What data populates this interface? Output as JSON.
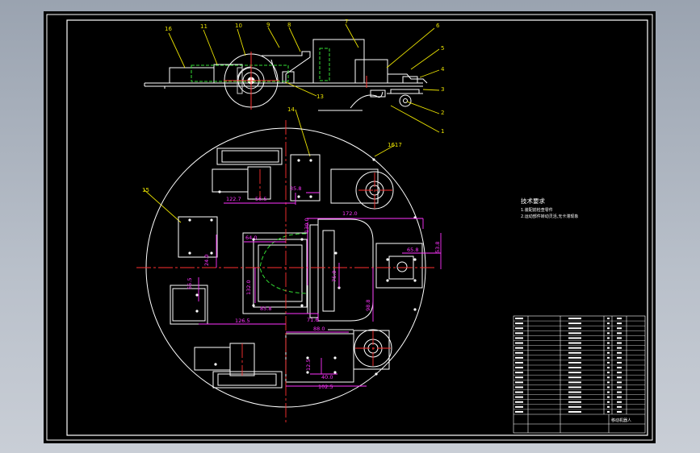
{
  "part_labels": {
    "p16": "16",
    "p11": "11",
    "p10": "10",
    "p9": "9",
    "p8": "8",
    "p7": "7",
    "p6": "6",
    "p5": "5",
    "p4": "4",
    "p3": "3",
    "p2": "2",
    "p1": "1",
    "p13": "13",
    "p14": "14",
    "p15": "15",
    "p1617": "1617"
  },
  "dimensions": {
    "d122_7": "122.7",
    "d56_5": "56.5",
    "d35_8": "35.8",
    "d172_0": "172.0",
    "d64_0": "64.0",
    "d130_0": "130.0",
    "d24_0": "24.0",
    "d65_8": "65.8",
    "d53_8": "53.8",
    "d55_5": "55.5",
    "d132_0": "132.0",
    "d75_0": "75.0",
    "d126_5": "126.5",
    "d71_6": "71.6",
    "d88_0": "88.0",
    "d98_8": "98.8",
    "d40_0": "40.0",
    "d12_5": "12.5",
    "d102_5": "102.5",
    "d85_8": "85.8"
  },
  "notes": {
    "title": "技术要求",
    "line1": "1.装配前检查零件",
    "line2": "2.运动部件转动灵活,无卡滞现象"
  },
  "title_block": {
    "name": "移动机器人"
  }
}
